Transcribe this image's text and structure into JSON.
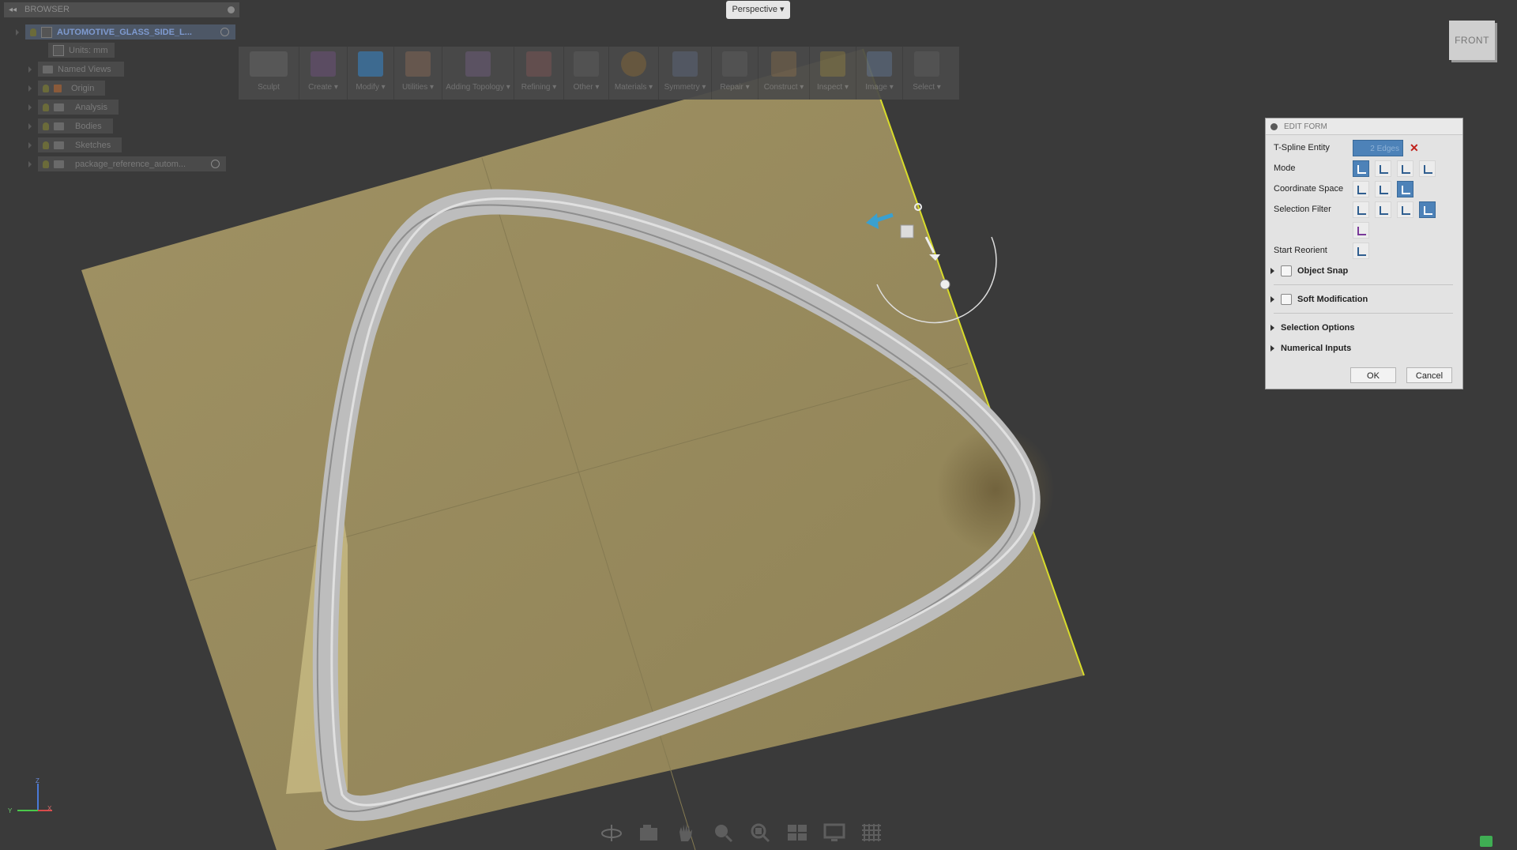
{
  "browser": {
    "header": "BROWSER",
    "root": "AUTOMOTIVE_GLASS_SIDE_L...",
    "items": [
      {
        "label": "Units: mm"
      },
      {
        "label": "Named Views"
      },
      {
        "label": "Origin"
      },
      {
        "label": "Analysis"
      },
      {
        "label": "Bodies"
      },
      {
        "label": "Sketches"
      },
      {
        "label": "package_reference_autom..."
      }
    ]
  },
  "toolbar": {
    "groups": [
      {
        "label": "Sculpt"
      },
      {
        "label": "Create ▾"
      },
      {
        "label": "Modify ▾",
        "active": true
      },
      {
        "label": "Utilities ▾"
      },
      {
        "label": "Adding Topology ▾"
      },
      {
        "label": "Refining ▾"
      },
      {
        "label": "Other ▾"
      },
      {
        "label": "Materials ▾"
      },
      {
        "label": "Symmetry ▾"
      },
      {
        "label": "Repair ▾"
      },
      {
        "label": "Construct ▾"
      },
      {
        "label": "Inspect ▾"
      },
      {
        "label": "Image ▾"
      },
      {
        "label": "Select ▾"
      }
    ]
  },
  "view": {
    "perspective": "Perspective ▾",
    "viewcube": "FRONT"
  },
  "edit_form": {
    "title": "EDIT FORM",
    "tspline_label": "T-Spline Entity",
    "tspline_value": "2 Edges",
    "mode_label": "Mode",
    "coord_label": "Coordinate Space",
    "filter_label": "Selection Filter",
    "reorient_label": "Start Reorient",
    "object_snap": "Object Snap",
    "soft_mod": "Soft Modification",
    "selection_options": "Selection Options",
    "numerical_inputs": "Numerical Inputs",
    "ok": "OK",
    "cancel": "Cancel"
  },
  "colors": {
    "background": "#3a3a3a",
    "plane": "#9e9060",
    "plane_edge": "#d8dc2a",
    "accent": "#4d82b8"
  },
  "triad": {
    "z": "Z",
    "x": "X",
    "y": "Y"
  }
}
